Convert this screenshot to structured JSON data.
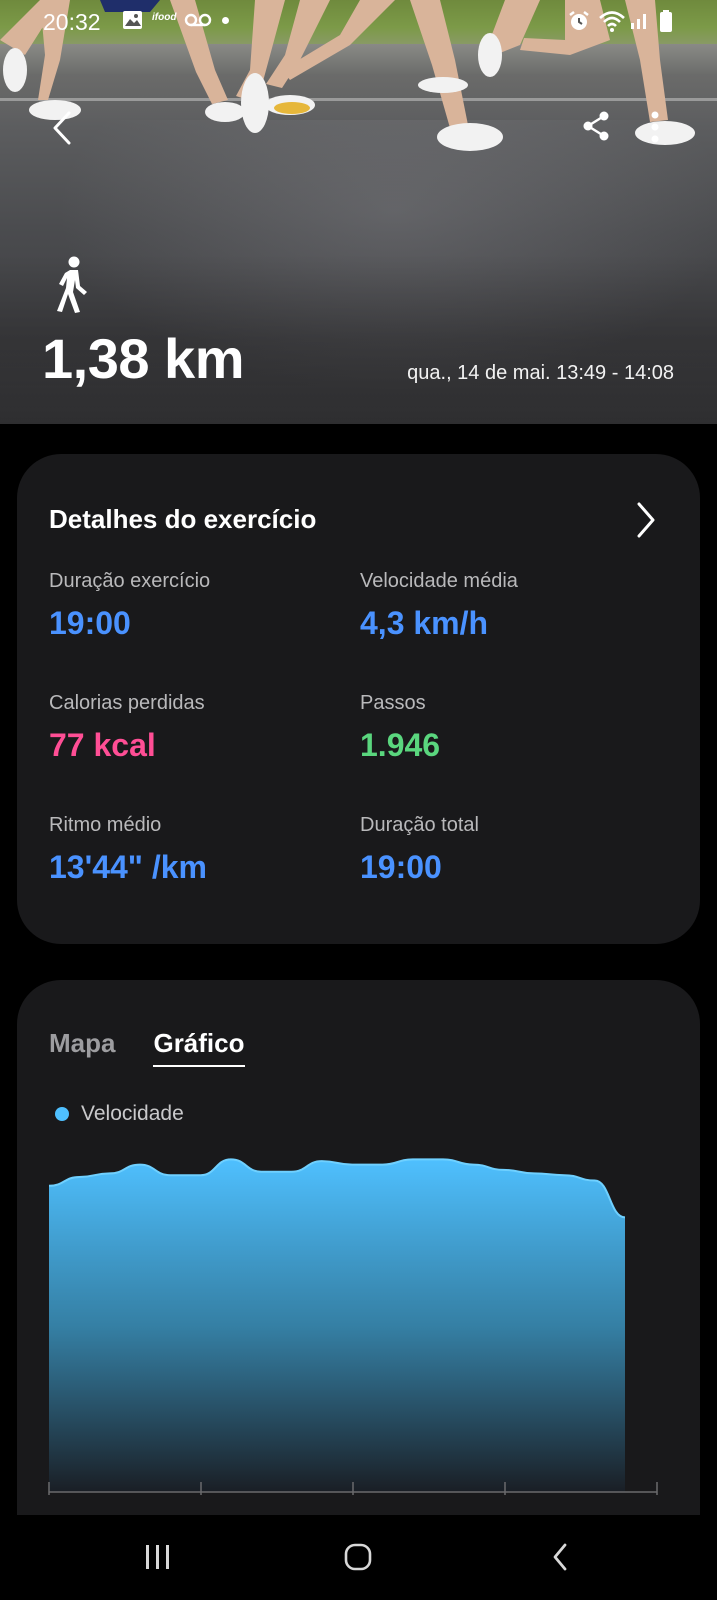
{
  "status_bar": {
    "time": "20:32",
    "badge": "ifood",
    "left_icons": [
      "image-icon",
      "ifood-icon",
      "voicemail-icon",
      "dot-icon"
    ],
    "right_icons": [
      "alarm-icon",
      "wifi-icon",
      "signal-icon",
      "battery-icon"
    ]
  },
  "header": {
    "actions": [
      "back-arrow-icon",
      "share-icon",
      "more-vert-icon"
    ]
  },
  "workout": {
    "activity_icon": "walk-icon",
    "distance": "1,38 km",
    "date_range": "qua., 14 de mai. 13:49 - 14:08"
  },
  "details": {
    "title": "Detalhes do exercício",
    "stats": [
      {
        "label": "Duração exercício",
        "value": "19:00",
        "color": "#4a92ff"
      },
      {
        "label": "Velocidade média",
        "value": "4,3 km/h",
        "color": "#4a92ff"
      },
      {
        "label": "Calorias perdidas",
        "value": "77 kcal",
        "color": "#ff4e95"
      },
      {
        "label": "Passos",
        "value": "1.946",
        "color": "#5ad67e"
      },
      {
        "label": "Ritmo médio",
        "value": "13'44\" /km",
        "color": "#4a92ff"
      },
      {
        "label": "Duração total",
        "value": "19:00",
        "color": "#4a92ff"
      }
    ]
  },
  "chart_section": {
    "tabs": [
      {
        "label": "Mapa",
        "active": false
      },
      {
        "label": "Gráfico",
        "active": true
      }
    ],
    "legend": "Velocidade"
  },
  "chart_data": {
    "type": "area",
    "title": "",
    "series": [
      {
        "name": "Velocidade",
        "color": "#4fc0ff",
        "values": [
          0.87,
          0.895,
          0.905,
          0.93,
          0.9,
          0.9,
          0.945,
          0.91,
          0.91,
          0.94,
          0.93,
          0.93,
          0.945,
          0.945,
          0.93,
          0.915,
          0.905,
          0.9,
          0.885,
          0.78
        ]
      }
    ],
    "ylim": [
      0,
      1
    ],
    "grid": false,
    "legend_position": "top-left"
  },
  "colors": {
    "background": "#000000",
    "card": "#19191b",
    "accent_blue": "#4a92ff",
    "accent_pink": "#ff4e95",
    "accent_green": "#5ad67e",
    "chart_fill": "#4fc0ff"
  },
  "nav_bar": {
    "buttons": [
      "recents-icon",
      "home-icon",
      "back-icon"
    ]
  }
}
